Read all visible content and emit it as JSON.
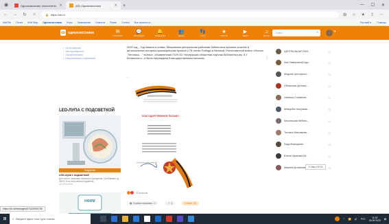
{
  "browser": {
    "tabs": [
      {
        "label": "Одноклассники: почитатели",
        "active": false
      },
      {
        "label": "(52) Одноклассники",
        "active": true
      }
    ],
    "url": "https://ok.ru",
    "bookmarks": [
      "Mail.Ru",
      "Почта",
      "Мой Мир",
      "Одноклассники",
      "Игры",
      "Знакомства",
      "Новости",
      "Поиск",
      "Combo",
      "Все проекты ▾"
    ],
    "bookmarks_right": [
      "Русский ▾",
      "Помощь"
    ],
    "status_url": "https://ok.ru/messages/574120094736"
  },
  "ok": {
    "logo": "одноклассники",
    "nav": [
      {
        "icon": "✉",
        "label": "Сообщения"
      },
      {
        "icon": "💬",
        "label": "Обсуждения"
      },
      {
        "icon": "🔔",
        "label": "Оповещения"
      },
      {
        "icon": "👥",
        "label": "Друзья"
      },
      {
        "icon": "👣",
        "label": "Гости"
      },
      {
        "icon": "★",
        "label": "События"
      },
      {
        "icon": "▶",
        "label": "Видео"
      },
      {
        "icon": "♫",
        "label": "Музыка"
      }
    ],
    "search_placeholder": "Поиск"
  },
  "left": {
    "links": [
      "Не интересует",
      "Уже приобретено",
      "Оскорбительное",
      "Неприемлемое содержание"
    ],
    "ad_title": "LED-ЛУПА С ПОДСВЕТКОЙ",
    "ad_button": "Подробнее",
    "ad_subtitle": "LED-лупа с подсветкой",
    "ad_desc": "Для шитья, вышивки, вязания и рукоделия. Приближает до 300%. Есть встроенная подсветка.",
    "ad_source": "ivel.shop.store",
    "ad2_title": "НФИМ"
  },
  "post": {
    "text": "2020 год – Год памяти и славы. Мещовская центральная районная библиотека приняла участие в региональном историко-краеведческом проекте к 75-летию Победы в Великой Отечественной войне «Листая \"Летопись…\" войны», объявленным ГБУК КО «Калужская областная научная библиотека им. В.Г. Белинского», и была награждена Благодарственным письмом.",
    "dots": "...",
    "doc_title": "БЛАГОДАРСТВЕННОЕ ПИСЬМО",
    "reactions": "35 классов",
    "comment_label": "Комментировать",
    "comment_count": "2",
    "share_count": "1",
    "class_label": "Класс!",
    "class_count": "35"
  },
  "friends": [
    {
      "name": "ЦЕНТРАЛЬНАЯ РАЙ...",
      "color": "#6a5a4a"
    },
    {
      "name": "Зоя Нимеровка(Сидо...",
      "color": "#7a5a3a"
    },
    {
      "name": "Медынь Центральн...",
      "color": "#555555"
    },
    {
      "name": "Областная Детская ...",
      "color": "#aa3322"
    },
    {
      "name": "Наталья Солманов...",
      "color": "#8a6a5a"
    },
    {
      "name": "Мемирбат Калуживс...",
      "color": "#4a5a6a"
    },
    {
      "name": "Мосальская библио...",
      "color": "#7a6a6a"
    },
    {
      "name": "Татьяна Максимова ...",
      "color": "#9a7a6a"
    },
    {
      "name": "Лида Верещагин...",
      "color": "#5a4a3a"
    },
    {
      "name": "Елена Чуканова (М...",
      "color": "#3a3a3a"
    },
    {
      "name": "Марина Архаимова",
      "color": "#8a5a5a"
    }
  ],
  "tooltip": "17 мая в 19:01",
  "taskbar": {
    "search_placeholder": "Введите здесь текст для поиска",
    "lang": "РУС",
    "time": "11:02",
    "date": "26.05.2020"
  }
}
